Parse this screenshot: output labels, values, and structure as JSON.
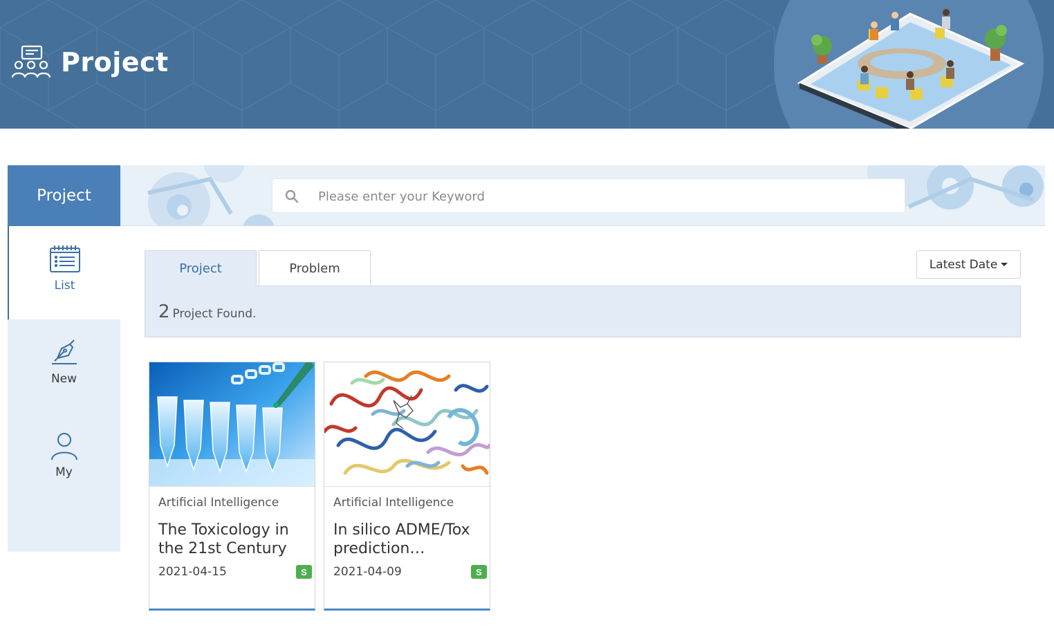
{
  "header": {
    "title": "Project"
  },
  "sidebar": {
    "title": "Project",
    "items": [
      {
        "label": "List",
        "icon": "list-calendar-icon",
        "active": true
      },
      {
        "label": "New",
        "icon": "pen-nib-icon",
        "active": false
      },
      {
        "label": "My",
        "icon": "user-icon",
        "active": false
      }
    ]
  },
  "search": {
    "placeholder": "Please enter your Keyword",
    "value": ""
  },
  "tabs": [
    {
      "label": "Project",
      "active": true
    },
    {
      "label": "Problem",
      "active": false
    }
  ],
  "sort": {
    "label": "Latest Date"
  },
  "results": {
    "count": "2",
    "text": "Project Found."
  },
  "cards": [
    {
      "category": "Artificial Intelligence",
      "title": "The Toxicology in the 21st Century",
      "date": "2021-04-15",
      "badge": "S"
    },
    {
      "category": "Artificial Intelligence",
      "title": "In silico ADME/Tox prediction…",
      "date": "2021-04-09",
      "badge": "S"
    }
  ],
  "colors": {
    "banner": "#44709a",
    "sidebar_head": "#4a7fb8",
    "sidebar_panel": "#e6eef7",
    "accent": "#3a6fa5",
    "badge": "#4cae4c"
  }
}
